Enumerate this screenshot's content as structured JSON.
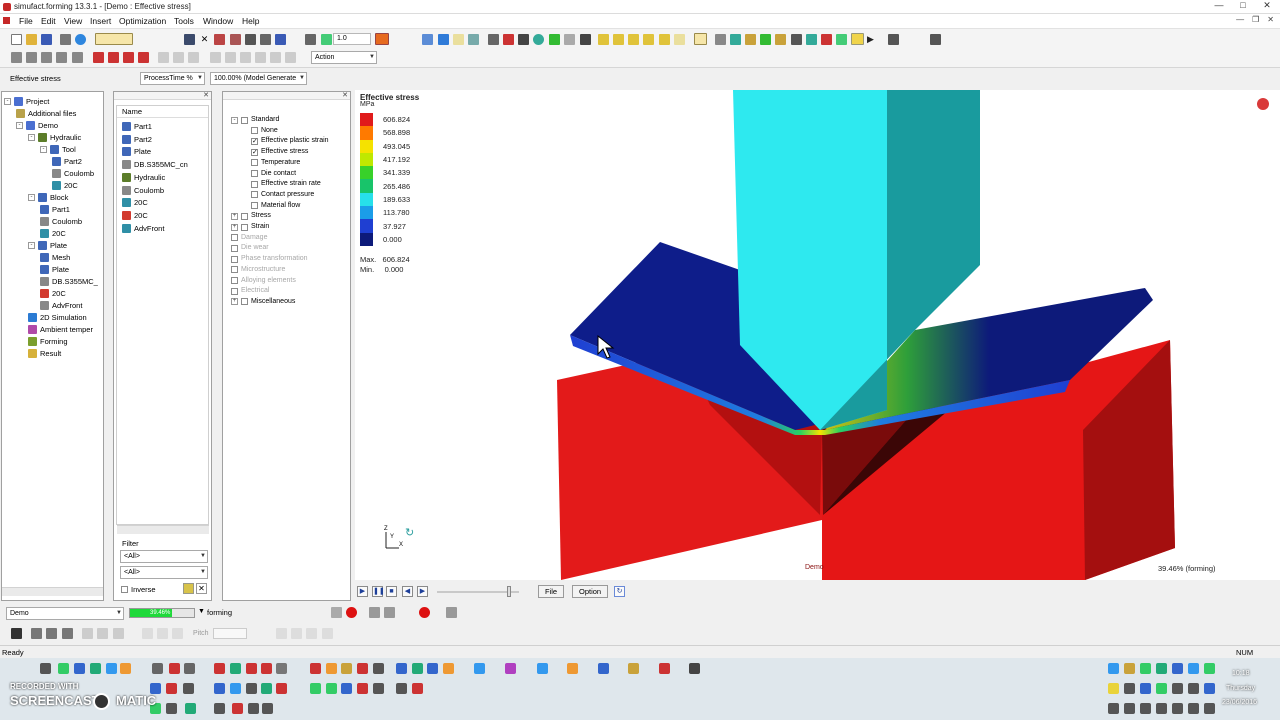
{
  "window": {
    "title": "simufact.forming 13.3.1 - [Demo : Effective stress]",
    "min_icon": "minimize-icon",
    "max_icon": "maximize-icon",
    "close_icon": "close-icon"
  },
  "menu": {
    "items": [
      "File",
      "Edit",
      "View",
      "Insert",
      "Optimization",
      "Tools",
      "Window",
      "Help"
    ]
  },
  "toolbar": {
    "spin_value": "1.0",
    "action_combo": "Action"
  },
  "result_bar": {
    "label": "Effective stress",
    "process_time": "ProcessTime %",
    "model_generate": "100.00% (Model Generate"
  },
  "project_tree": {
    "items": [
      {
        "label": "Project",
        "icon": "project-icon"
      },
      {
        "label": "Additional files",
        "icon": "additional-files-icon"
      },
      {
        "label": "Demo",
        "icon": "folder-icon"
      },
      {
        "label": "Hydraulic",
        "icon": "hydraulic-icon"
      },
      {
        "label": "Tool",
        "icon": "part-icon"
      },
      {
        "label": "Part2",
        "icon": "part-icon"
      },
      {
        "label": "Coulomb",
        "icon": "friction-icon"
      },
      {
        "label": "20C",
        "icon": "temperature-icon"
      },
      {
        "label": "Block",
        "icon": "part-icon"
      },
      {
        "label": "Part1",
        "icon": "part-icon"
      },
      {
        "label": "Coulomb",
        "icon": "friction-icon"
      },
      {
        "label": "20C",
        "icon": "temperature-icon"
      },
      {
        "label": "Plate",
        "icon": "part-icon"
      },
      {
        "label": "Mesh",
        "icon": "mesh-icon"
      },
      {
        "label": "Plate",
        "icon": "part-icon"
      },
      {
        "label": "DB.S355MC_",
        "icon": "material-icon"
      },
      {
        "label": "20C",
        "icon": "temperature-icon"
      },
      {
        "label": "AdvFront",
        "icon": "mesher-icon"
      },
      {
        "label": "2D Simulation",
        "icon": "simulation-icon"
      },
      {
        "label": "Ambient temper",
        "icon": "ambient-icon"
      },
      {
        "label": "Forming",
        "icon": "forming-icon"
      },
      {
        "label": "Result",
        "icon": "result-icon"
      }
    ]
  },
  "catalog": {
    "header": "Name",
    "items": [
      {
        "label": "Part1"
      },
      {
        "label": "Part2"
      },
      {
        "label": "Plate"
      },
      {
        "label": "DB.S355MC_cn"
      },
      {
        "label": "Hydraulic"
      },
      {
        "label": "Coulomb"
      },
      {
        "label": "20C"
      },
      {
        "label": "20C"
      },
      {
        "label": "AdvFront"
      }
    ],
    "filter_label": "Filter",
    "filter1": "<All>",
    "filter2": "<All>",
    "inverse": "Inverse"
  },
  "results_tree": {
    "items": [
      {
        "label": "Standard",
        "checked": false,
        "enabled": true
      },
      {
        "label": "None",
        "checked": false,
        "enabled": true
      },
      {
        "label": "Effective plastic strain",
        "checked": true,
        "enabled": true
      },
      {
        "label": "Effective stress",
        "checked": true,
        "enabled": true
      },
      {
        "label": "Temperature",
        "checked": false,
        "enabled": true
      },
      {
        "label": "Die contact",
        "checked": false,
        "enabled": true
      },
      {
        "label": "Effective strain rate",
        "checked": false,
        "enabled": true
      },
      {
        "label": "Contact pressure",
        "checked": false,
        "enabled": true
      },
      {
        "label": "Material flow",
        "checked": false,
        "enabled": true
      },
      {
        "label": "Stress",
        "checked": false,
        "enabled": true
      },
      {
        "label": "Strain",
        "checked": false,
        "enabled": true
      },
      {
        "label": "Damage",
        "checked": false,
        "enabled": false
      },
      {
        "label": "Die wear",
        "checked": false,
        "enabled": false
      },
      {
        "label": "Phase transformation",
        "checked": false,
        "enabled": false
      },
      {
        "label": "Microstructure",
        "checked": false,
        "enabled": false
      },
      {
        "label": "Alloying elements",
        "checked": false,
        "enabled": false
      },
      {
        "label": "Electrical",
        "checked": false,
        "enabled": false
      },
      {
        "label": "Miscellaneous",
        "checked": false,
        "enabled": true
      }
    ]
  },
  "legend": {
    "title": "Effective stress",
    "unit": "MPa",
    "values": [
      "606.824",
      "568.898",
      "493.045",
      "417.192",
      "341.339",
      "265.486",
      "189.633",
      "113.780",
      "37.927",
      "0.000"
    ],
    "colors": [
      "#e01b1b",
      "#ff7a00",
      "#f5e200",
      "#bfe800",
      "#38d12a",
      "#18c46a",
      "#27e0ea",
      "#1b9de8",
      "#1f3fd2",
      "#0d1a7a"
    ],
    "max_label": "Max.",
    "max_value": "606.824",
    "min_label": "Min.",
    "min_value": "0.000"
  },
  "viewport": {
    "model_label": "Demo",
    "progress_text": "39.46% (forming)",
    "axis_labels": {
      "z": "Z",
      "y": "Y",
      "x": "X"
    }
  },
  "playback": {
    "file_btn": "File",
    "option_btn": "Option",
    "progress": 0.39
  },
  "status": {
    "process_combo": "Demo",
    "progress_text": "forming",
    "bar_label": "39.46%",
    "bar_fraction": 0.66,
    "pitch": "Pitch",
    "ready": "Ready",
    "num": "NUM"
  },
  "taskbar": {
    "recorded_with": "RECORDED WITH",
    "screencast": "SCREENCAST",
    "matic": "MATIC",
    "time": "10:18",
    "day": "Thursday",
    "date": "23/06/2016"
  }
}
